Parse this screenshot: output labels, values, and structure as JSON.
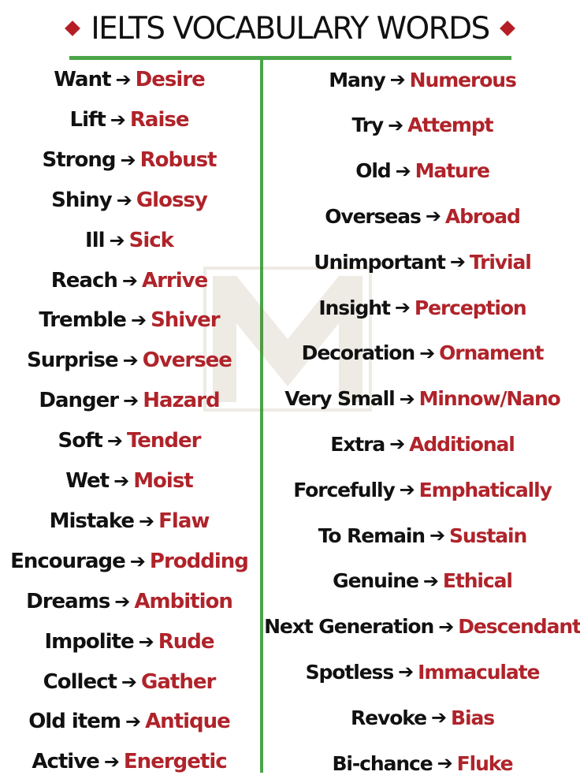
{
  "header": {
    "title": "IELTS VOCABULARY WORDS"
  },
  "colors": {
    "word": "#111111",
    "synonym": "#b0232a",
    "divider": "#4aa547",
    "diamond": "#b41e24"
  },
  "arrow_symbol": "➔",
  "left_column": [
    {
      "word": "Want",
      "synonym": "Desire"
    },
    {
      "word": "Lift",
      "synonym": "Raise"
    },
    {
      "word": "Strong",
      "synonym": "Robust"
    },
    {
      "word": "Shiny",
      "synonym": "Glossy"
    },
    {
      "word": "Ill",
      "synonym": "Sick"
    },
    {
      "word": "Reach",
      "synonym": "Arrive"
    },
    {
      "word": "Tremble",
      "synonym": "Shiver"
    },
    {
      "word": "Surprise",
      "synonym": "Oversee"
    },
    {
      "word": "Danger",
      "synonym": "Hazard"
    },
    {
      "word": "Soft",
      "synonym": "Tender"
    },
    {
      "word": "Wet",
      "synonym": "Moist"
    },
    {
      "word": "Mistake",
      "synonym": "Flaw"
    },
    {
      "word": "Encourage",
      "synonym": "Prodding"
    },
    {
      "word": "Dreams",
      "synonym": "Ambition"
    },
    {
      "word": "Impolite",
      "synonym": "Rude"
    },
    {
      "word": "Collect",
      "synonym": "Gather"
    },
    {
      "word": "Old item",
      "synonym": "Antique"
    },
    {
      "word": "Active",
      "synonym": "Energetic"
    }
  ],
  "right_column": [
    {
      "word": "Many",
      "synonym": "Numerous"
    },
    {
      "word": "Try",
      "synonym": "Attempt"
    },
    {
      "word": "Old",
      "synonym": "Mature"
    },
    {
      "word": "Overseas",
      "synonym": "Abroad"
    },
    {
      "word": "Unimportant",
      "synonym": "Trivial"
    },
    {
      "word": "Insight",
      "synonym": "Perception"
    },
    {
      "word": "Decoration",
      "synonym": "Ornament"
    },
    {
      "word": "Very Small",
      "synonym": "Minnow/Nano"
    },
    {
      "word": "Extra",
      "synonym": "Additional"
    },
    {
      "word": "Forcefully",
      "synonym": "Emphatically"
    },
    {
      "word": "To Remain",
      "synonym": "Sustain"
    },
    {
      "word": "Genuine",
      "synonym": "Ethical"
    },
    {
      "word": "Next Generation",
      "synonym": "Descendant"
    },
    {
      "word": "Spotless",
      "synonym": "Immaculate"
    },
    {
      "word": "Revoke",
      "synonym": "Bias"
    },
    {
      "word": "Bi-chance",
      "synonym": "Fluke"
    }
  ]
}
